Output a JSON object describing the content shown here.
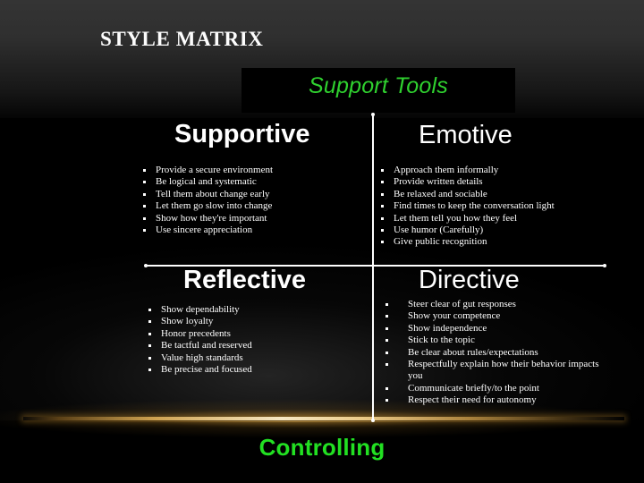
{
  "slide": {
    "deck_title": "STYLE MATRIX",
    "axis_top_label": "Support Tools",
    "axis_bottom_label": "Controlling",
    "colors": {
      "axis_top_green": "#2fd12f",
      "axis_bottom_green": "#22e022",
      "heading_white": "#ffffff",
      "background_black": "#000000",
      "gold_band": "#f6e8c4"
    }
  },
  "quadrants": [
    {
      "id": "supportive",
      "heading": "Supportive",
      "items": [
        "Provide a secure environment",
        "Be logical and systematic",
        "Tell them about change early",
        "Let them go slow into change",
        "Show how they're important",
        "Use sincere appreciation"
      ]
    },
    {
      "id": "emotive",
      "heading": "Emotive",
      "items": [
        "Approach them informally",
        "Provide written details",
        "Be relaxed and sociable",
        "Find times to keep the conversation light",
        "Let them tell you how they feel",
        "Use humor (Carefully)",
        "Give public recognition"
      ]
    },
    {
      "id": "reflective",
      "heading": "Reflective",
      "items": [
        "Show dependability",
        "Show loyalty",
        "Honor precedents",
        "Be tactful and reserved",
        "Value high standards",
        "Be precise and focused"
      ]
    },
    {
      "id": "directive",
      "heading": "Directive",
      "items": [
        "Steer clear of gut responses",
        "Show your competence",
        "Show independence",
        "Stick to the topic",
        "Be clear about rules/expectations",
        "Respectfully explain how their behavior impacts you",
        "Communicate briefly/to the point",
        "Respect their need for autonomy"
      ]
    }
  ]
}
